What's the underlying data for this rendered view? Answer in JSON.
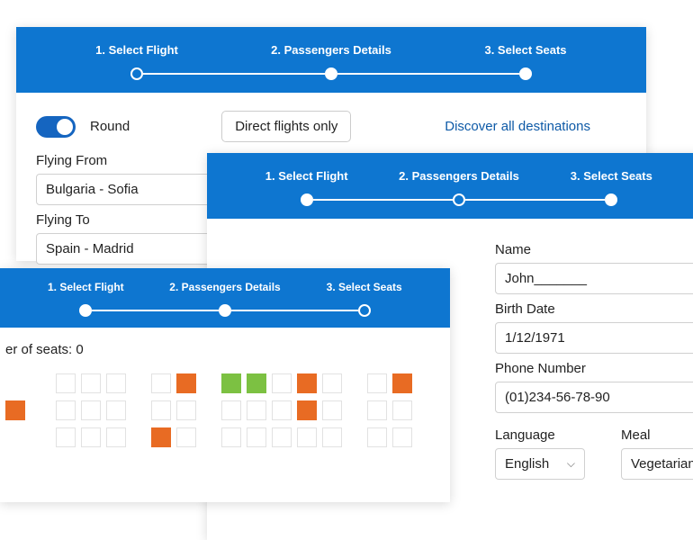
{
  "wizard": {
    "steps": [
      "1. Select Flight",
      "2. Passengers Details",
      "3. Select Seats"
    ]
  },
  "panelA": {
    "round_label": "Round",
    "direct_btn": "Direct flights only",
    "discover_link": "Discover all destinations",
    "from_label": "Flying From",
    "from_value": "Bulgaria - Sofia",
    "to_label": "Flying To",
    "to_value": "Spain - Madrid"
  },
  "panelB": {
    "name_label": "Name",
    "name_value": "John_______",
    "birth_label": "Birth Date",
    "birth_value": "1/12/1971",
    "phone_label": "Phone Number",
    "phone_value": "(01)234-56-78-90",
    "lang_label": "Language",
    "lang_value": "English",
    "meal_label": "Meal",
    "meal_value": "Vegetarian"
  },
  "panelC": {
    "count_label": "er of seats:  0",
    "rows": [
      [
        "",
        "",
        "e",
        "e",
        "e",
        "a",
        "e",
        "t",
        "a",
        "s",
        "s",
        "e",
        "t",
        "e",
        "a",
        "e",
        "t",
        ""
      ],
      [
        "t",
        "",
        "e",
        "e",
        "e",
        "a",
        "e",
        "e",
        "a",
        "e",
        "e",
        "e",
        "t",
        "e",
        "a",
        "e",
        "e",
        ""
      ],
      [
        "",
        "",
        "e",
        "e",
        "e",
        "a",
        "t",
        "e",
        "a",
        "e",
        "e",
        "e",
        "e",
        "e",
        "a",
        "e",
        "e",
        ""
      ]
    ]
  }
}
